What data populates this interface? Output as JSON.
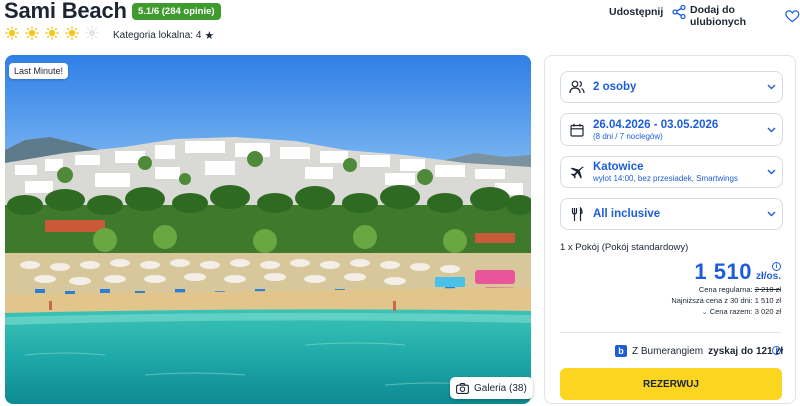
{
  "hotel": {
    "name": "Sami Beach",
    "rating_badge": "5.1/6 (284 opinie)",
    "sun_rating": 4,
    "sun_total": 5,
    "local_category": "Kategoria lokalna: 4",
    "share_label": "Udostępnij",
    "favorite_label": "Dodaj do ulubionych"
  },
  "gallery": {
    "badge": "Last Minute!",
    "label": "Galeria (38)"
  },
  "booking": {
    "persons": "2 osoby",
    "dates": "26.04.2026 - 03.05.2026",
    "dates_sub": "(8 dni / 7 noclegów)",
    "departure": "Katowice",
    "departure_sub": "wylot 14:00, bez przesiadek, Smartwings",
    "board": "All inclusive",
    "room": "1 x Pokój  (Pokój standardowy)",
    "price": "1 510",
    "price_unit": "zł/os.",
    "regular_label": "Cena regularna:",
    "regular_value": "2 210 zł",
    "lowest_30": "Najniższa cena z 30 dni: 1 510 zł",
    "total": "Cena razem: 3 020 zł",
    "bumerang_prefix": "Z Bumerangiem",
    "bumerang_bold": "zyskaj do 121 zł",
    "reserve_label": "REZERWUJ"
  },
  "colors": {
    "brand_blue": "#1d5ed8",
    "rating_green": "#3f9b2e",
    "cta_yellow": "#fbd520",
    "sun_yellow": "#f5c518"
  }
}
